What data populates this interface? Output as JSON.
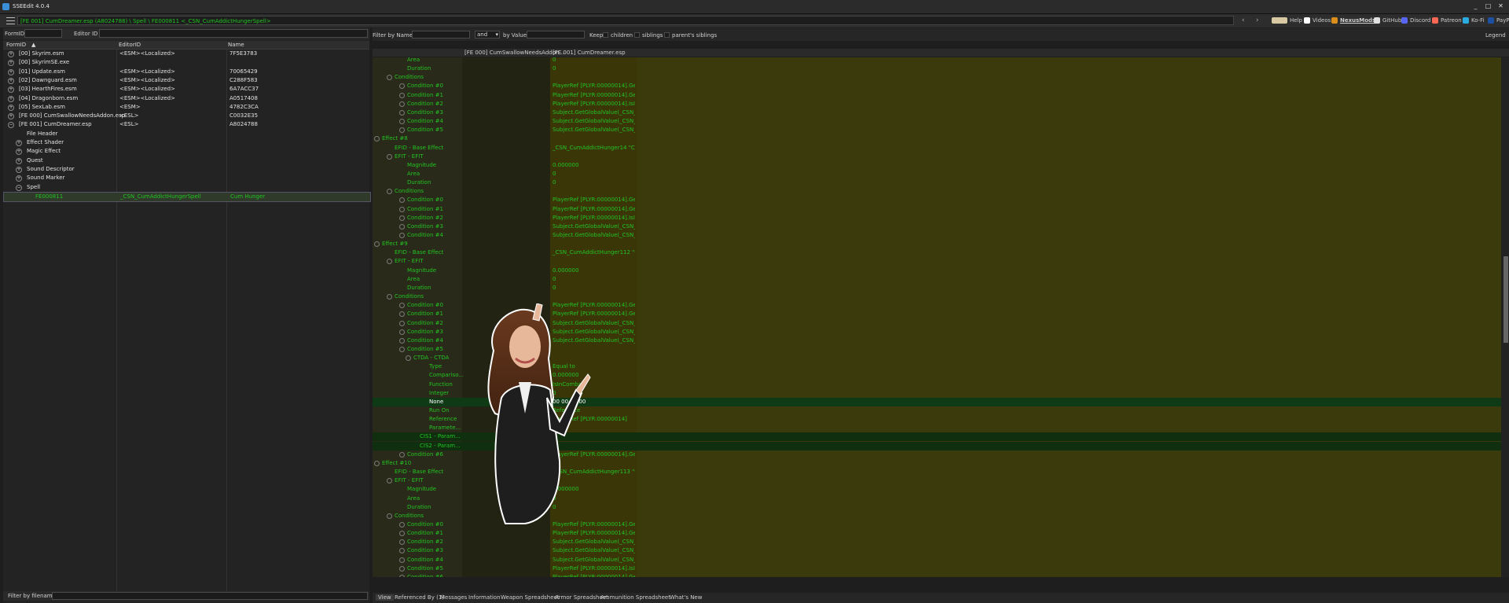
{
  "window": {
    "title": "SSEEdit 4.0.4"
  },
  "path": {
    "text": "[FE 001] CumDreamer.esp (A8024788) \\ Spell \\ FE000811 <_CSN_CumAddictHungerSpell>"
  },
  "toplinks": [
    "Help",
    "Videos",
    "NexusMods",
    "GitHub",
    "Discord",
    "Patreon",
    "Ko-Fi",
    "PayPal"
  ],
  "search": {
    "formid_label": "FormID",
    "editorid_label": "Editor ID"
  },
  "left_columns": {
    "formid": "FormID",
    "editorid": "EditorID",
    "name": "Name"
  },
  "left_tree": [
    {
      "plus": "+",
      "c1": "[00] Skyrim.esm",
      "c2": "<ESM><Localized>",
      "c3": "7F5E3783"
    },
    {
      "plus": "+",
      "c1": "[00] SkyrimSE.exe",
      "c2": "",
      "c3": ""
    },
    {
      "plus": "+",
      "c1": "[01] Update.esm",
      "c2": "<ESM><Localized>",
      "c3": "70065429"
    },
    {
      "plus": "+",
      "c1": "[02] Dawnguard.esm",
      "c2": "<ESM><Localized>",
      "c3": "C288F583"
    },
    {
      "plus": "+",
      "c1": "[03] HearthFires.esm",
      "c2": "<ESM><Localized>",
      "c3": "6A7ACC37"
    },
    {
      "plus": "+",
      "c1": "[04] Dragonborn.esm",
      "c2": "<ESM><Localized>",
      "c3": "A0517408"
    },
    {
      "plus": "+",
      "c1": "[05] SexLab.esm",
      "c2": "<ESM>",
      "c3": "4782C3CA"
    },
    {
      "plus": "+",
      "c1": "[FE 000] CumSwallowNeedsAddon.esp",
      "c2": "<ESL>",
      "c3": "C0032E35"
    },
    {
      "plus": "−",
      "c1": "[FE 001] CumDreamer.esp",
      "c2": "<ESL>",
      "c3": "A8024788"
    },
    {
      "plus": "",
      "c1": "File Header",
      "c2": "",
      "c3": ""
    },
    {
      "plus": "+",
      "c1": "Effect Shader",
      "c2": "",
      "c3": ""
    },
    {
      "plus": "+",
      "c1": "Magic Effect",
      "c2": "",
      "c3": ""
    },
    {
      "plus": "+",
      "c1": "Quest",
      "c2": "",
      "c3": ""
    },
    {
      "plus": "+",
      "c1": "Sound Descriptor",
      "c2": "",
      "c3": ""
    },
    {
      "plus": "+",
      "c1": "Sound Marker",
      "c2": "",
      "c3": ""
    },
    {
      "plus": "−",
      "c1": "Spell",
      "c2": "",
      "c3": ""
    },
    {
      "plus": "",
      "c1": "FE000811",
      "c2": "_CSN_CumAddictHungerSpell",
      "c3": "Cum Hunger"
    }
  ],
  "filter_filename": {
    "label": "Filter by filename:"
  },
  "right_filter": {
    "filter_by_name": "Filter by Name:",
    "and": "and",
    "by_value": "by Value:",
    "keep": "Keep",
    "children": "children",
    "siblings": "siblings",
    "parents_siblings": "parent's siblings",
    "legend": "Legend"
  },
  "grid_headers": {
    "col2": "[FE 000] CumSwallowNeedsAddon...",
    "col3": "[FE 001] CumDreamer.esp"
  },
  "grid_rows": [
    {
      "label": "Area",
      "value": "0"
    },
    {
      "label": "Duration",
      "value": "0"
    },
    {
      "label": "Conditions",
      "value": ""
    },
    {
      "label": "Condition #0",
      "value": "PlayerRef [PLYR:00000014].GetA..."
    },
    {
      "label": "Condition #1",
      "value": "PlayerRef [PLYR:00000014].GetIn..."
    },
    {
      "label": "Condition #2",
      "value": "PlayerRef [PLYR:00000014].IsInC..."
    },
    {
      "label": "Condition #3",
      "value": "Subject.GetGlobalValue(_CSN_C..."
    },
    {
      "label": "Condition #4",
      "value": "Subject.GetGlobalValue(_CSN_C..."
    },
    {
      "label": "Condition #5",
      "value": "Subject.GetGlobalValue(_CSN_C..."
    },
    {
      "label": "Effect #8",
      "value": ""
    },
    {
      "label": "EFID - Base Effect",
      "value": "_CSN_CumAddictHunger14 \"Cu..."
    },
    {
      "label": "EFIT - EFIT",
      "value": ""
    },
    {
      "label": "Magnitude",
      "value": "0.000000"
    },
    {
      "label": "Area",
      "value": "0"
    },
    {
      "label": "Duration",
      "value": "0"
    },
    {
      "label": "Conditions",
      "value": ""
    },
    {
      "label": "Condition #0",
      "value": "PlayerRef [PLYR:00000014].GetA..."
    },
    {
      "label": "Condition #1",
      "value": "PlayerRef [PLYR:00000014].GetIn..."
    },
    {
      "label": "Condition #2",
      "value": "PlayerRef [PLYR:00000014].IsInC..."
    },
    {
      "label": "Condition #3",
      "value": "Subject.GetGlobalValue(_CSN_C..."
    },
    {
      "label": "Condition #4",
      "value": "Subject.GetGlobalValue(_CSN_C..."
    },
    {
      "label": "Effect #9",
      "value": ""
    },
    {
      "label": "EFID - Base Effect",
      "value": "_CSN_CumAddictHunger112 \"C..."
    },
    {
      "label": "EFIT - EFIT",
      "value": ""
    },
    {
      "label": "Magnitude",
      "value": "0.000000"
    },
    {
      "label": "Area",
      "value": "0"
    },
    {
      "label": "Duration",
      "value": "0"
    },
    {
      "label": "Conditions",
      "value": ""
    },
    {
      "label": "Condition #0",
      "value": "PlayerRef [PLYR:00000014].GetA..."
    },
    {
      "label": "Condition #1",
      "value": "PlayerRef [PLYR:00000014].GetA..."
    },
    {
      "label": "Condition #2",
      "value": "Subject.GetGlobalValue(_CSN_C..."
    },
    {
      "label": "Condition #3",
      "value": "Subject.GetGlobalValue(_CSN_C..."
    },
    {
      "label": "Condition #4",
      "value": "Subject.GetGlobalValue(_CSN_C..."
    },
    {
      "label": "Condition #5",
      "value": ""
    },
    {
      "label": "CTDA - CTDA",
      "value": ""
    },
    {
      "label": "Type",
      "value": "Equal to"
    },
    {
      "label": "Compariso...",
      "value": "0.000000"
    },
    {
      "label": "Function",
      "value": "IsInCombat"
    },
    {
      "label": "Integer",
      "value": "0"
    },
    {
      "label": "None",
      "value": "00 00 00 00"
    },
    {
      "label": "Run On",
      "value": "Reference"
    },
    {
      "label": "Reference",
      "value": "PlayerRef [PLYR:00000014]"
    },
    {
      "label": "Paramete...",
      "value": ""
    },
    {
      "label": "CIS1 - Param...",
      "value": ""
    },
    {
      "label": "CIS2 - Param...",
      "value": ""
    },
    {
      "label": "Condition #6",
      "value": "PlayerRef [PLYR:00000014].GetIn..."
    },
    {
      "label": "Effect #10",
      "value": ""
    },
    {
      "label": "EFID - Base Effect",
      "value": "_CSN_CumAddictHunger113 \"C..."
    },
    {
      "label": "EFIT - EFIT",
      "value": ""
    },
    {
      "label": "Magnitude",
      "value": "0.000000"
    },
    {
      "label": "Area",
      "value": "0"
    },
    {
      "label": "Duration",
      "value": "0"
    },
    {
      "label": "Conditions",
      "value": ""
    },
    {
      "label": "Condition #0",
      "value": "PlayerRef [PLYR:00000014].GetA..."
    },
    {
      "label": "Condition #1",
      "value": "PlayerRef [PLYR:00000014].GetA..."
    },
    {
      "label": "Condition #2",
      "value": "Subject.GetGlobalValue(_CSN_C..."
    },
    {
      "label": "Condition #3",
      "value": "Subject.GetGlobalValue(_CSN_C..."
    },
    {
      "label": "Condition #4",
      "value": "Subject.GetGlobalValue(_CSN_C..."
    },
    {
      "label": "Condition #5",
      "value": "PlayerRef [PLYR:00000014].IsInC..."
    },
    {
      "label": "Condition #6",
      "value": "PlayerRef [PLYR:00000014].GetIn..."
    },
    {
      "label": "Effect #11",
      "value": ""
    }
  ],
  "tabs": [
    "View",
    "Referenced By (1)",
    "Messages",
    "Information",
    "Weapon Spreadsheet",
    "Armor Spreadsheet",
    "Ammunition Spreadsheet",
    "What's New"
  ],
  "colors": {
    "green": "#22c322",
    "grid_bg": "#3b3a0c",
    "highlight": "#0e3a15"
  }
}
